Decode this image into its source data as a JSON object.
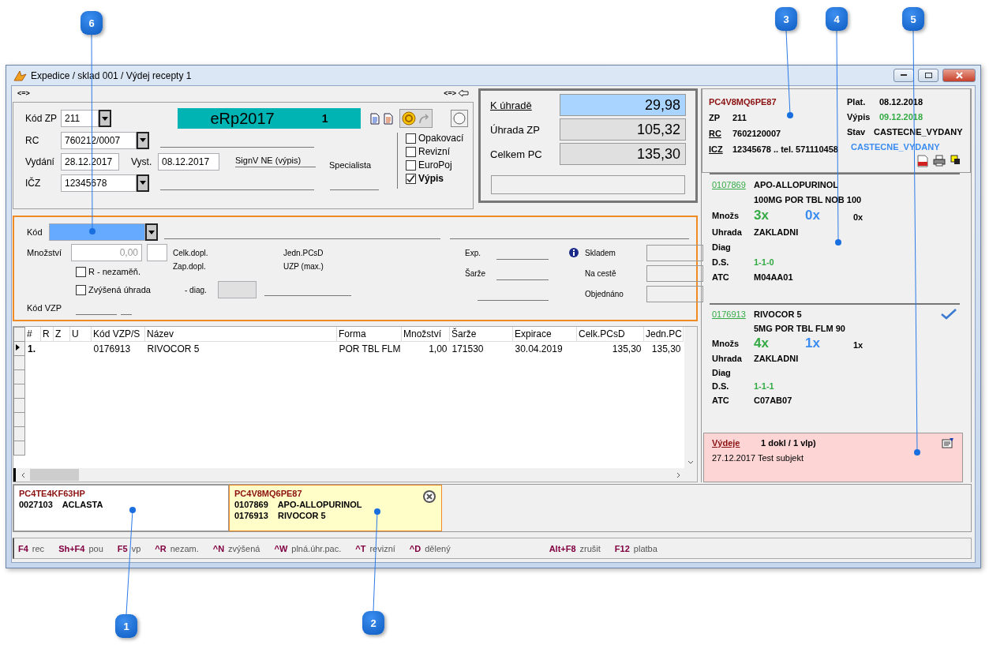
{
  "callouts": [
    {
      "label": "6"
    },
    {
      "label": "3"
    },
    {
      "label": "4"
    },
    {
      "label": "5"
    },
    {
      "label": "1"
    },
    {
      "label": "2"
    }
  ],
  "window": {
    "title": "Expedice / sklad 001 / Výdej recepty 1"
  },
  "nav": {
    "left": "<=>",
    "right": "<=>"
  },
  "prescription": {
    "insurer": {
      "label": "Kód ZP",
      "value": "211"
    },
    "banner": {
      "title": "eRp2017",
      "number": "1"
    },
    "rc": {
      "label": "RC",
      "value": "760212/0007"
    },
    "issued": {
      "label": "Vydání",
      "value": "28.12.2017"
    },
    "written": {
      "label": "Vyst.",
      "value": "08.12.2017"
    },
    "signature": "SignV NE (výpis)",
    "specialist": "Specialista",
    "icz": {
      "label": "IČZ",
      "value": "12345678"
    },
    "flags": [
      {
        "label": "Opakovací",
        "checked": false
      },
      {
        "label": "Revizní",
        "checked": false
      },
      {
        "label": "EuroPoj",
        "checked": false
      },
      {
        "label": "Výpis",
        "checked": true
      }
    ]
  },
  "payment": {
    "rows": [
      {
        "label": "K úhradě",
        "value": "29,98",
        "selected": true
      },
      {
        "label": "Úhrada ZP",
        "value": "105,32",
        "selected": false
      },
      {
        "label": "Celkem PC",
        "value": "135,30",
        "selected": false
      }
    ]
  },
  "item_form": {
    "code_label": "Kód",
    "quantity_label": "Množství",
    "quantity_placeholder": "0,00",
    "total_copay": "Celk.dopl.",
    "unit_price": "Jedn.PCsD",
    "paid_copay": "Zap.dopl.",
    "max_price": "UZP (max.)",
    "options": [
      {
        "label": "R - nezaměň.",
        "checked": false
      },
      {
        "label": "Zvýšená úhrada",
        "checked": false
      }
    ],
    "diag_label": "- diag.",
    "vzp_label": "Kód VZP",
    "expiry_label": "Exp.",
    "batch_label": "Šarže",
    "stock": [
      {
        "label": "Skladem"
      },
      {
        "label": "Na cestě"
      },
      {
        "label": "Objednáno"
      }
    ]
  },
  "table": {
    "columns": [
      "#",
      "R",
      "Z",
      "U",
      "Kód VZP/S",
      "Název",
      "Forma",
      "Množství",
      "Šarže",
      "Expirace",
      "Celk.PCsD",
      "Jedn.PC"
    ],
    "rows": [
      {
        "number": "1.",
        "code": "0176913",
        "name": "RIVOCOR 5",
        "form": "POR TBL FLM",
        "quantity": "1,00",
        "batch": "171530",
        "expiry": "30.04.2019",
        "total": "135,30",
        "unit": "135,30",
        "selected": true
      }
    ]
  },
  "detail": {
    "id": "PC4V8MQ6PE87",
    "fields": [
      {
        "label": "ZP",
        "value": "211",
        "underlined": false
      },
      {
        "label": "RC",
        "value": "7602120007",
        "underlined": true
      },
      {
        "label": "ICZ",
        "value": "12345678 .. tel. 571110458",
        "underlined": true
      }
    ],
    "dates": [
      {
        "label": "Plat.",
        "value": "08.12.2018",
        "color": "#000000"
      },
      {
        "label": "Výpis",
        "value": "09.12.2018",
        "color": "#33aa44"
      },
      {
        "label": "Stav",
        "value": "CASTECNE_VYDANY",
        "color": "#000000"
      }
    ],
    "status": "CASTECNE_VYDANY"
  },
  "drugs": [
    {
      "code": "0107869",
      "name": "APO-ALLOPURINOL",
      "strength": "100MG POR TBL NOB 100",
      "quantity_label": "Množs",
      "prescribed": "3x",
      "dispensed": "0x",
      "count": "0x",
      "reimbursement_label": "Uhrada",
      "reimbursement": "ZAKLADNI",
      "diag_label": "Diag",
      "dosage_label": "D.S.",
      "dosage": "1-1-0",
      "atc_label": "ATC",
      "atc": "M04AA01",
      "done": false
    },
    {
      "code": "0176913",
      "name": "RIVOCOR 5",
      "strength": "5MG POR TBL FLM 90",
      "quantity_label": "Množs",
      "prescribed": "4x",
      "dispensed": "1x",
      "count": "1x",
      "reimbursement_label": "Uhrada",
      "reimbursement": "ZAKLADNI",
      "diag_label": "Diag",
      "dosage_label": "D.S.",
      "dosage": "1-1-1",
      "atc_label": "ATC",
      "atc": "C07AB07",
      "done": true
    }
  ],
  "dispenses": {
    "title": "Výdeje",
    "summary": "1 dokl / 1 vlp)",
    "entries": [
      "27.12.2017 Test subjekt"
    ]
  },
  "prescription_tabs": [
    {
      "code": "PC4TE4KF63HP",
      "items": [
        {
          "code": "0027103",
          "name": "ACLASTA"
        }
      ],
      "selected": false
    },
    {
      "code": "PC4V8MQ6PE87",
      "items": [
        {
          "code": "0107869",
          "name": "APO-ALLOPURINOL"
        },
        {
          "code": "0176913",
          "name": "RIVOCOR 5"
        }
      ],
      "selected": true
    }
  ],
  "function_keys": {
    "left": [
      {
        "key": "F4",
        "label": "rec"
      },
      {
        "key": "Sh+F4",
        "label": "pou"
      },
      {
        "key": "F5",
        "label": "vp"
      },
      {
        "key": "^R",
        "label": "nezam."
      },
      {
        "key": "^N",
        "label": "zvýšená"
      },
      {
        "key": "^W",
        "label": "plná.úhr.pac."
      },
      {
        "key": "^T",
        "label": "revizní"
      },
      {
        "key": "^D",
        "label": "dělený"
      }
    ],
    "right": [
      {
        "key": "Alt+F8",
        "label": "zrušit"
      },
      {
        "key": "F12",
        "label": "platba"
      }
    ]
  }
}
